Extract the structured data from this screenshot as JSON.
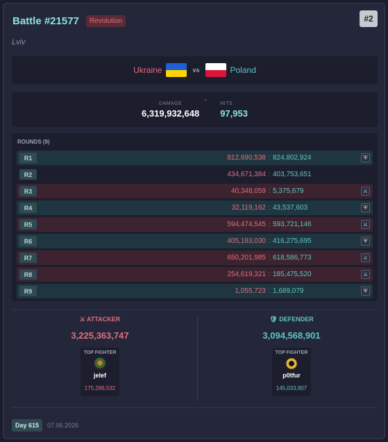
{
  "battle": {
    "title": "Battle #21577",
    "type_badge": "Revolution",
    "rank": "#2",
    "region": "Lviv"
  },
  "matchup": {
    "attacker": "Ukraine",
    "vs": "vs",
    "defender": "Poland",
    "attacker_flag_colors": [
      "#1f5fd6",
      "#ffd400"
    ],
    "defender_flag_colors": [
      "#ffffff",
      "#dc143c"
    ]
  },
  "stats": {
    "damage_label": "DAMAGE",
    "damage_value": "6,319,932,648",
    "hits_label": "HITS",
    "hits_value": "97,953"
  },
  "rounds": {
    "header": "ROUNDS (9)",
    "items": [
      {
        "label": "R1",
        "attacker": "812,690,538",
        "defender": "824,802,924",
        "winner": "defender",
        "icon": "shield-icon"
      },
      {
        "label": "R2",
        "attacker": "434,671,384",
        "defender": "403,753,651",
        "winner": "none",
        "icon": ""
      },
      {
        "label": "R3",
        "attacker": "40,348,059",
        "defender": "5,375,679",
        "winner": "attacker",
        "icon": "swords-icon"
      },
      {
        "label": "R4",
        "attacker": "32,119,162",
        "defender": "43,537,603",
        "winner": "defender",
        "icon": "shield-icon"
      },
      {
        "label": "R5",
        "attacker": "594,474,545",
        "defender": "593,721,146",
        "winner": "attacker",
        "icon": "swords-icon"
      },
      {
        "label": "R6",
        "attacker": "405,183,030",
        "defender": "416,275,695",
        "winner": "defender",
        "icon": "shield-icon"
      },
      {
        "label": "R7",
        "attacker": "650,201,985",
        "defender": "618,586,773",
        "winner": "attacker",
        "icon": "swords-icon"
      },
      {
        "label": "R8",
        "attacker": "254,619,321",
        "defender": "185,475,520",
        "winner": "attacker",
        "icon": "swords-icon"
      },
      {
        "label": "R9",
        "attacker": "1,055,723",
        "defender": "1,689,079",
        "winner": "defender",
        "icon": "shield-icon"
      }
    ],
    "separator": ":"
  },
  "attacker_side": {
    "title": "⚔ ATTACKER",
    "total": "3,225,363,747",
    "top_label": "TOP FIGHTER",
    "name": "jelef",
    "damage": "175,286,532"
  },
  "defender_side": {
    "title": "🛡 DEFENDER",
    "total": "3,094,568,901",
    "top_label": "TOP FIGHTER",
    "name": "p0tfur",
    "damage": "145,033,907"
  },
  "footer": {
    "day": "Day 615",
    "date": "07.06.2026"
  },
  "colors": {
    "attacker": "#e36e7a",
    "defender": "#5ec6c1",
    "title": "#8ee3e0"
  }
}
